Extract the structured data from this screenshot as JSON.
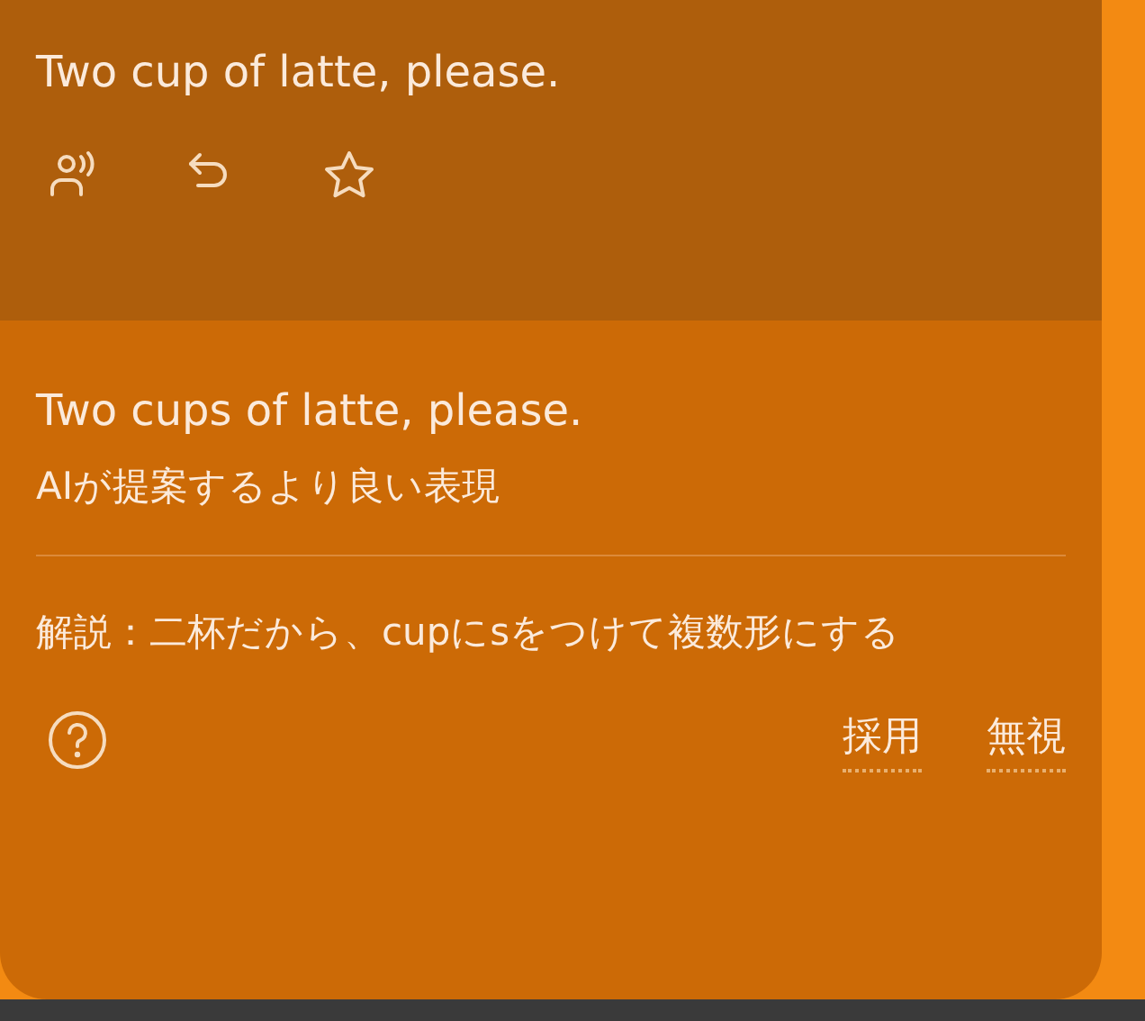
{
  "original": {
    "text": "Two cup of latte, please."
  },
  "actions": [
    {
      "kind": "speak"
    },
    {
      "kind": "undo"
    },
    {
      "kind": "star"
    }
  ],
  "suggestion": {
    "text": "Two cups of latte, please.",
    "caption": "AIが提案するより良い表現"
  },
  "explanation": "解説：二杯だから、cupにsをつけて複数形にする",
  "footer": {
    "buttons": [
      "採用",
      "無視"
    ]
  }
}
